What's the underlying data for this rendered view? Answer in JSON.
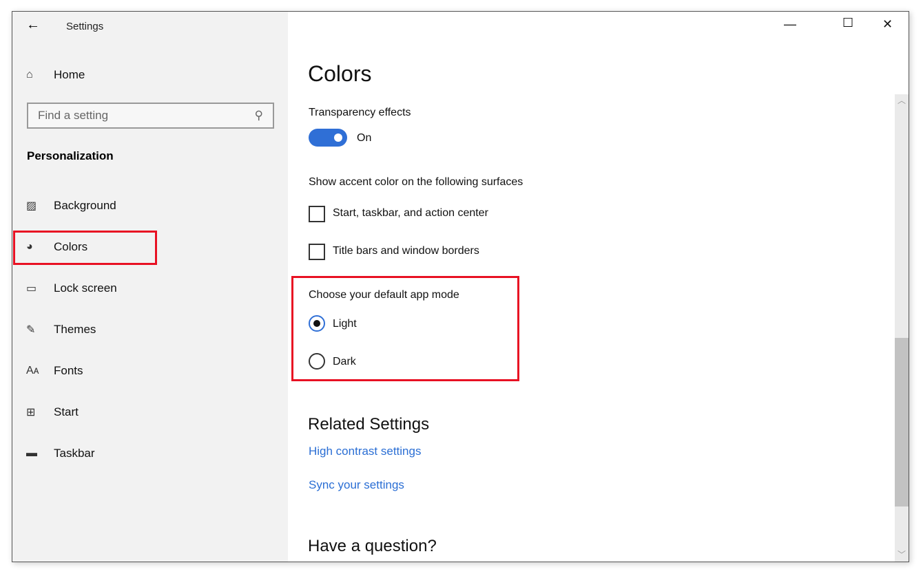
{
  "window": {
    "title": "Settings",
    "minimize": "—",
    "maximize": "☐",
    "close": "✕"
  },
  "sidebar": {
    "home": "Home",
    "search_placeholder": "Find a setting",
    "section": "Personalization",
    "items": [
      {
        "label": "Background",
        "icon": "image-icon"
      },
      {
        "label": "Colors",
        "icon": "palette-icon"
      },
      {
        "label": "Lock screen",
        "icon": "lock-screen-icon"
      },
      {
        "label": "Themes",
        "icon": "themes-icon"
      },
      {
        "label": "Fonts",
        "icon": "fonts-icon"
      },
      {
        "label": "Start",
        "icon": "start-icon"
      },
      {
        "label": "Taskbar",
        "icon": "taskbar-icon"
      }
    ],
    "selected": "Colors"
  },
  "main": {
    "title": "Colors",
    "transparency_label": "Transparency effects",
    "transparency_state": "On",
    "transparency_on": true,
    "accent_label": "Show accent color on the following surfaces",
    "checkboxes": [
      {
        "label": "Start, taskbar, and action center",
        "checked": false
      },
      {
        "label": "Title bars and window borders",
        "checked": false
      }
    ],
    "app_mode_label": "Choose your default app mode",
    "app_modes": [
      {
        "label": "Light",
        "selected": true
      },
      {
        "label": "Dark",
        "selected": false
      }
    ],
    "related_title": "Related Settings",
    "links": [
      "High contrast settings",
      "Sync your settings"
    ],
    "question_title": "Have a question?"
  },
  "colors": {
    "accent": "#2f6fd6",
    "highlight": "#e81123",
    "link": "#2a6ed4"
  }
}
